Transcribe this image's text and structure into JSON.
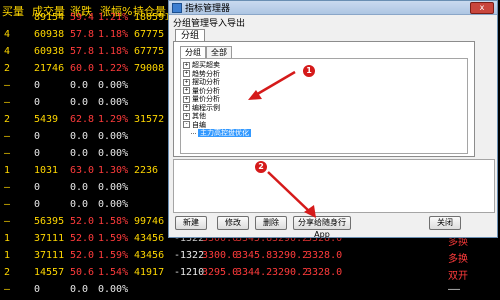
{
  "table": {
    "headers": [
      "买量",
      "成交量",
      "涨跌",
      "涨幅%",
      "持仓量"
    ],
    "rows": [
      [
        "",
        "89154",
        "59.4",
        "1.21%",
        "180591",
        "",
        "",
        "",
        "",
        "",
        ""
      ],
      [
        "4",
        "60938",
        "57.8",
        "1.18%",
        "67775",
        "",
        "",
        "",
        "",
        "",
        ""
      ],
      [
        "4",
        "60938",
        "57.8",
        "1.18%",
        "67775",
        "",
        "",
        "",
        "",
        "",
        ""
      ],
      [
        "2",
        "21746",
        "60.0",
        "1.22%",
        "79008",
        "",
        "",
        "",
        "",
        "",
        ""
      ],
      [
        "—",
        "0",
        "0.0",
        "0.00%",
        "",
        "",
        "",
        "",
        "",
        "",
        ""
      ],
      [
        "—",
        "0",
        "0.0",
        "0.00%",
        "",
        "",
        "",
        "",
        "",
        "",
        ""
      ],
      [
        "2",
        "5439",
        "62.8",
        "1.29%",
        "31572",
        "",
        "",
        "",
        "",
        "",
        ""
      ],
      [
        "—",
        "0",
        "0.0",
        "0.00%",
        "",
        "",
        "",
        "",
        "",
        "",
        ""
      ],
      [
        "—",
        "0",
        "0.0",
        "0.00%",
        "",
        "",
        "",
        "",
        "",
        "",
        ""
      ],
      [
        "1",
        "1031",
        "63.0",
        "1.30%",
        "2236",
        "",
        "",
        "",
        "",
        "",
        ""
      ],
      [
        "—",
        "0",
        "0.0",
        "0.00%",
        "",
        "",
        "",
        "",
        "",
        "",
        ""
      ],
      [
        "—",
        "0",
        "0.0",
        "0.00%",
        "",
        "",
        "",
        "",
        "",
        "",
        ""
      ],
      [
        "—",
        "56395",
        "52.0",
        "1.58%",
        "99746",
        "",
        "",
        "",
        "",
        "",
        ""
      ],
      [
        "1",
        "37111",
        "52.0",
        "1.59%",
        "43456",
        "-1322",
        "3300.0",
        "3345.8",
        "3290.2",
        "3328.0",
        "多换"
      ],
      [
        "1",
        "37111",
        "52.0",
        "1.59%",
        "43456",
        "-1322",
        "3300.0",
        "3345.8",
        "3290.2",
        "3328.0",
        "多换"
      ],
      [
        "2",
        "14557",
        "50.6",
        "1.54%",
        "41917",
        "-1210",
        "3295.0",
        "3344.2",
        "3290.2",
        "3328.0",
        "双开"
      ],
      [
        "—",
        "0",
        "0.0",
        "0.00%",
        "",
        "",
        "",
        "",
        "",
        "",
        "——"
      ]
    ]
  },
  "dialog": {
    "title": "指标管理器",
    "menu": [
      "分组管理",
      "导入导出"
    ],
    "tab": "分组",
    "subtabs": [
      "分组",
      "全部"
    ],
    "tree": [
      {
        "label": "超买超卖",
        "expander": "+"
      },
      {
        "label": "趋势分析",
        "expander": "+"
      },
      {
        "label": "摆动分析",
        "expander": "+"
      },
      {
        "label": "量价分析",
        "expander": "+"
      },
      {
        "label": "量价分析",
        "expander": "+"
      },
      {
        "label": "编程示例",
        "expander": "+"
      },
      {
        "label": "其他",
        "expander": "+"
      },
      {
        "label": "自编",
        "expander": "-"
      },
      {
        "label": "主力高控盘优化",
        "expander": ""
      }
    ],
    "buttons": {
      "new": "新建",
      "edit": "修改",
      "delete": "删除",
      "share": "分享给随身行App",
      "close": "关闭"
    },
    "close_glyph": "x"
  },
  "annotations": {
    "badge1": "1",
    "badge2": "2",
    "arrow_color": "#d51a1a"
  }
}
